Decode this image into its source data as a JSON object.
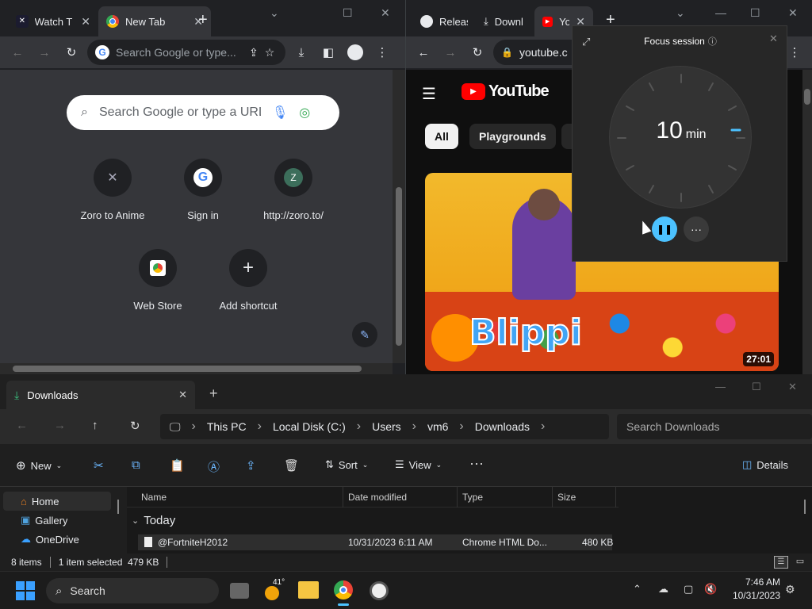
{
  "chrome_left": {
    "tabs": [
      {
        "title": "Watch T",
        "icon": "zoro-icon"
      },
      {
        "title": "New Tab",
        "icon": "chrome-icon"
      }
    ],
    "omnibox_placeholder": "Search Google or type...",
    "ntp_search_placeholder": "Search Google or type a URL",
    "shortcuts": [
      {
        "label": "Zoro to Anime",
        "icon": "zoro-icon"
      },
      {
        "label": "Sign in",
        "icon": "google-icon"
      },
      {
        "label": "http://zoro.to/",
        "letter": "Z"
      },
      {
        "label": "Web Store",
        "icon": "webstore-icon"
      },
      {
        "label": "Add shortcut",
        "icon": "plus-icon"
      }
    ]
  },
  "chrome_right": {
    "tabs": [
      {
        "title": "Releas",
        "icon": "github-icon"
      },
      {
        "title": "Downl",
        "icon": "download-icon"
      },
      {
        "title": "Yo",
        "icon": "youtube-icon"
      }
    ],
    "omnibox_text": "youtube.c",
    "youtube": {
      "logo_text": "YouTube",
      "chips": [
        "All",
        "Playgrounds"
      ],
      "video_duration": "27:01",
      "thumbnail_text": "Blippi"
    }
  },
  "focus": {
    "title": "Focus session",
    "time_value": "10",
    "time_unit": "min"
  },
  "explorer": {
    "tab_title": "Downloads",
    "breadcrumbs": [
      "This PC",
      "Local Disk (C:)",
      "Users",
      "vm6",
      "Downloads"
    ],
    "search_placeholder": "Search Downloads",
    "commands": {
      "new": "New",
      "sort": "Sort",
      "view": "View",
      "details": "Details"
    },
    "sidebar": [
      "Home",
      "Gallery",
      "OneDrive"
    ],
    "columns": [
      "Name",
      "Date modified",
      "Type",
      "Size"
    ],
    "group": "Today",
    "files": [
      {
        "name": "@FortniteH2012",
        "date": "10/31/2023 6:11 AM",
        "type": "Chrome HTML Do...",
        "size": "480 KB"
      }
    ],
    "status": {
      "items": "8 items",
      "selected": "1 item selected  479 KB"
    }
  },
  "taskbar": {
    "search_label": "Search",
    "weather": "41°",
    "time": "7:46 AM",
    "date": "10/31/2023"
  }
}
